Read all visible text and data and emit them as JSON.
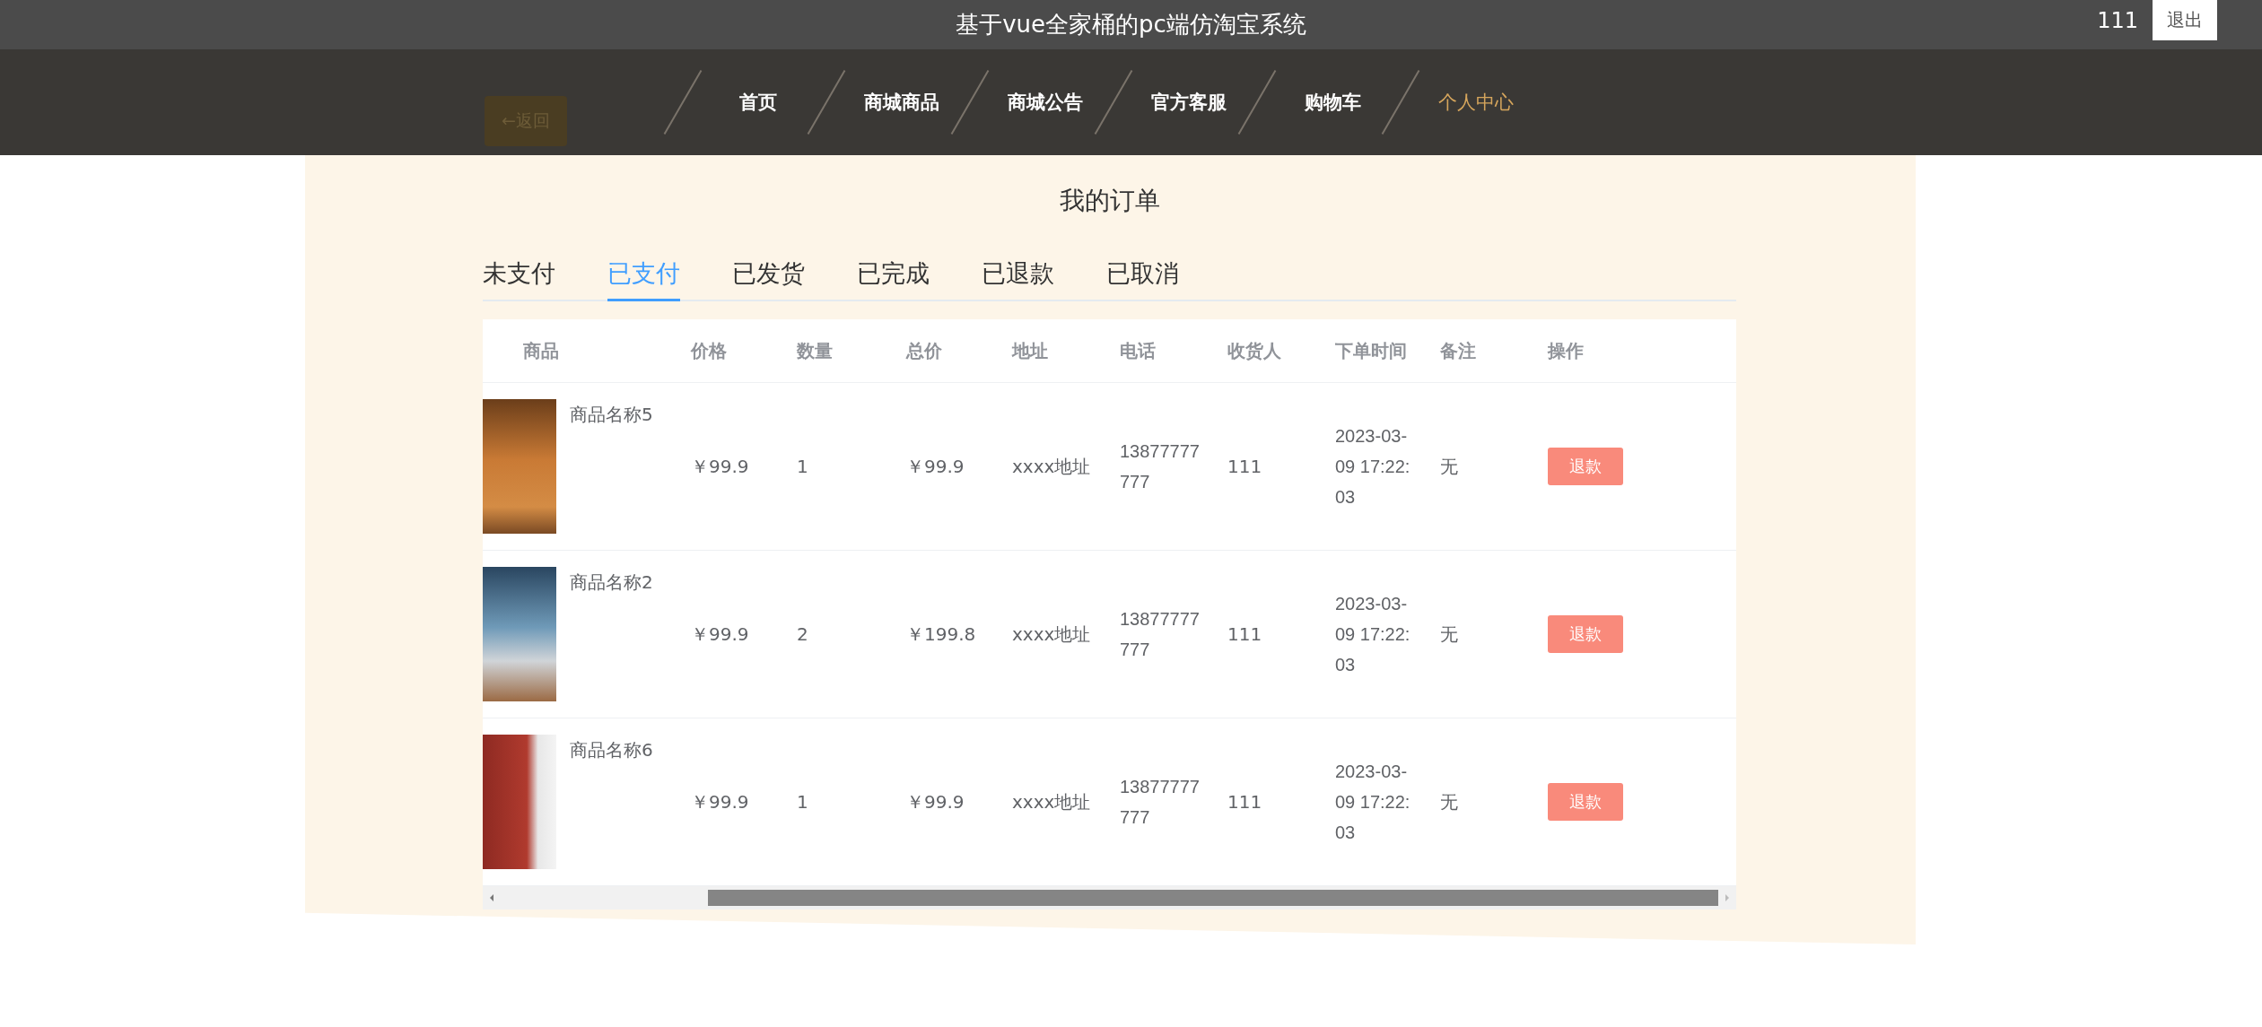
{
  "header": {
    "title": "基于vue全家桶的pc端仿淘宝系统",
    "username": "111",
    "logout_button": "退出"
  },
  "nav": {
    "back_button": "←返回",
    "items": [
      {
        "label": "首页",
        "selected": false
      },
      {
        "label": "商城商品",
        "selected": false
      },
      {
        "label": "商城公告",
        "selected": false
      },
      {
        "label": "官方客服",
        "selected": false
      },
      {
        "label": "购物车",
        "selected": false
      },
      {
        "label": "个人中心",
        "selected": true
      }
    ]
  },
  "page_title": "我的订单",
  "tabs": [
    {
      "label": "未支付",
      "selected": false
    },
    {
      "label": "已支付",
      "selected": true
    },
    {
      "label": "已发货",
      "selected": false
    },
    {
      "label": "已完成",
      "selected": false
    },
    {
      "label": "已退款",
      "selected": false
    },
    {
      "label": "已取消",
      "selected": false
    }
  ],
  "table": {
    "columns": [
      "商品",
      "价格",
      "数量",
      "总价",
      "地址",
      "电话",
      "收货人",
      "下单时间",
      "备注",
      "操作"
    ],
    "rows": [
      {
        "name": "商品名称5",
        "price": "￥99.9",
        "quantity": "1",
        "total": "￥99.9",
        "address": "xxxx地址",
        "phone": "13877777777",
        "receiver": "111",
        "time": "2023-03-09 17:22:03",
        "remark": "无",
        "action": "退款"
      },
      {
        "name": "商品名称2",
        "price": "￥99.9",
        "quantity": "2",
        "total": "￥199.8",
        "address": "xxxx地址",
        "phone": "13877777777",
        "receiver": "111",
        "time": "2023-03-09 17:22:03",
        "remark": "无",
        "action": "退款"
      },
      {
        "name": "商品名称6",
        "price": "￥99.9",
        "quantity": "1",
        "total": "￥99.9",
        "address": "xxxx地址",
        "phone": "13877777777",
        "receiver": "111",
        "time": "2023-03-09 17:22:03",
        "remark": "无",
        "action": "退款"
      }
    ]
  }
}
